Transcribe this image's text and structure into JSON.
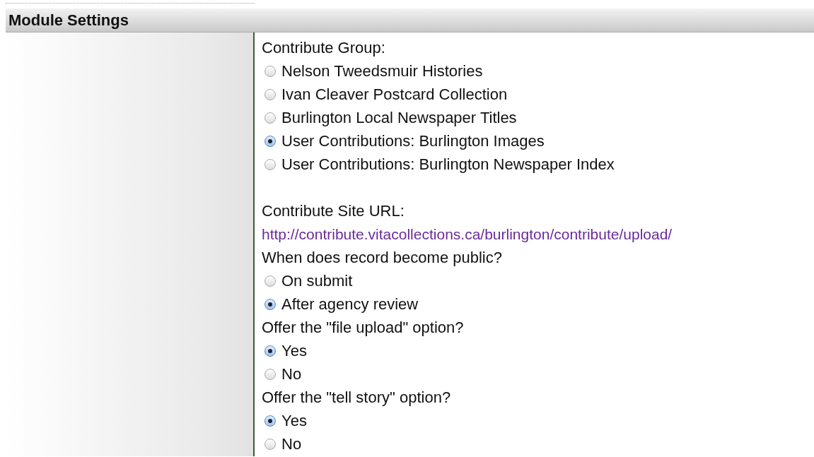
{
  "section": {
    "title": "Module Settings"
  },
  "fields": [
    {
      "kind": "radio_group",
      "label": "Contribute Group:",
      "options": [
        {
          "label": "Nelson Tweedsmuir Histories",
          "selected": false
        },
        {
          "label": "Ivan Cleaver Postcard Collection",
          "selected": false
        },
        {
          "label": "Burlington Local Newspaper Titles",
          "selected": false
        },
        {
          "label": "User Contributions: Burlington Images",
          "selected": true
        },
        {
          "label": "User Contributions: Burlington Newspaper Index",
          "selected": false
        }
      ]
    },
    {
      "kind": "link",
      "label": "Contribute Site URL:",
      "url": "http://contribute.vitacollections.ca/burlington/contribute/upload/"
    },
    {
      "kind": "radio_group",
      "label": "When does record become public?",
      "options": [
        {
          "label": "On submit",
          "selected": false
        },
        {
          "label": "After agency review",
          "selected": true
        }
      ]
    },
    {
      "kind": "radio_group",
      "label": "Offer the \"file upload\" option?",
      "options": [
        {
          "label": "Yes",
          "selected": true
        },
        {
          "label": "No",
          "selected": false
        }
      ]
    },
    {
      "kind": "radio_group",
      "label": "Offer the \"tell story\" option?",
      "options": [
        {
          "label": "Yes",
          "selected": true
        },
        {
          "label": "No",
          "selected": false
        }
      ]
    }
  ]
}
